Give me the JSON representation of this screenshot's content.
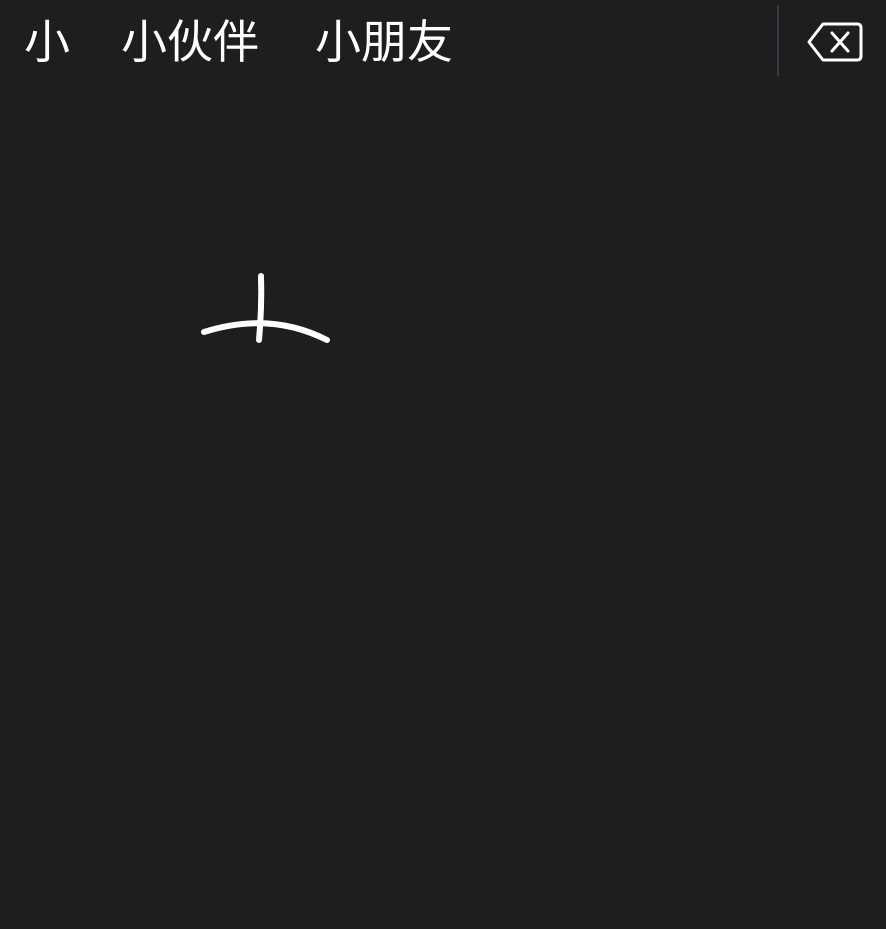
{
  "candidates": [
    "小",
    "小伙伴",
    "小朋友"
  ],
  "backspace": {
    "icon": "delete-backward-icon"
  },
  "handwriting": {
    "strokes": 2
  },
  "colors": {
    "background": "#1e1d20",
    "text": "#ffffff",
    "divider": "#3a393d",
    "ink": "#ffffff"
  }
}
